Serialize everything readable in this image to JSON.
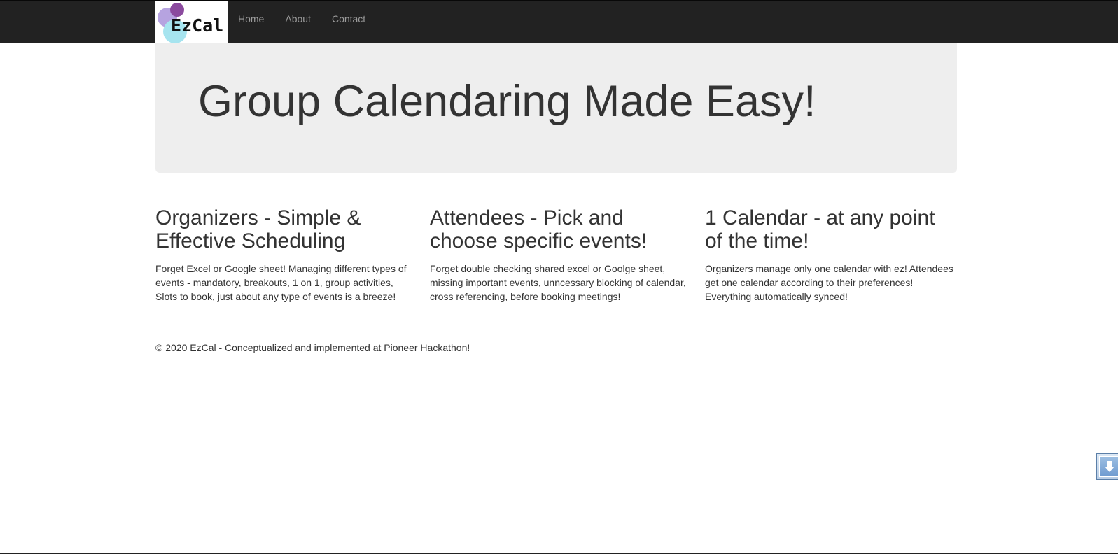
{
  "navbar": {
    "brand_text": "EzCal",
    "links": [
      "Home",
      "About",
      "Contact"
    ]
  },
  "hero": {
    "title": "Group Calendaring Made Easy!"
  },
  "features": [
    {
      "heading": "Organizers - Simple & Effective Scheduling",
      "text": "Forget Excel or Google sheet! Managing different types of events - mandatory, breakouts, 1 on 1, group activities, Slots to book, just about any type of events is a breeze!"
    },
    {
      "heading": "Attendees - Pick and choose specific events!",
      "text": "Forget double checking shared excel or Goolge sheet, missing important events, unncessary blocking of calendar, cross referencing, before booking meetings!"
    },
    {
      "heading": "1 Calendar - at any point of the time!",
      "text": "Organizers manage only one calendar with ez! Attendees get one calendar according to their preferences! Everything automatically synced!"
    }
  ],
  "footer": {
    "text": "© 2020 EzCal - Conceptualized and implemented at Pioneer Hackathon!"
  },
  "scroll_button": {
    "icon": "arrow-down-icon"
  },
  "colors": {
    "navbar_bg": "#222222",
    "nav_link": "#9d9d9d",
    "jumbotron_bg": "#eeeeee",
    "text": "#333333"
  }
}
